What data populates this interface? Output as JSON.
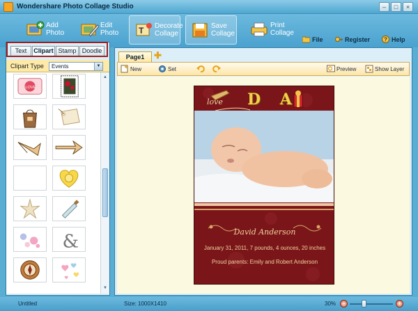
{
  "window": {
    "title": "Wondershare Photo Collage Studio",
    "controls": [
      "minimize",
      "maximize",
      "close"
    ]
  },
  "toolbar": {
    "tools": [
      {
        "name": "add-photo",
        "label": "Add\nPhoto",
        "icon": "add-photo-icon",
        "active": false
      },
      {
        "name": "edit-photo",
        "label": "Edit\nPhoto",
        "icon": "edit-photo-icon",
        "active": false
      },
      {
        "name": "decorate-collage",
        "label": "Decorate\nCollage",
        "icon": "decorate-collage-icon",
        "active": true
      },
      {
        "name": "save-collage",
        "label": "Save\nCollage",
        "icon": "save-collage-icon",
        "active": false
      },
      {
        "name": "print-collage",
        "label": "Print\nCollage",
        "icon": "print-collage-icon",
        "active": false
      }
    ],
    "file_label": "File",
    "register_label": "Register",
    "help_label": "Help"
  },
  "left_panel": {
    "tabs": [
      "Text",
      "Clipart",
      "Stamp",
      "Doodle"
    ],
    "active_tab": "Clipart",
    "clip_type_label": "Clipart Type",
    "clip_type_value": "Events",
    "clips": [
      "valentine-love-clip",
      "framed-roses-clip",
      "gift-bag-clip",
      "gift-tag-clip",
      "arrow-left-clip",
      "arrow-right-clip",
      "blank-clip",
      "yellow-heart-clip",
      "starfish-clip",
      "message-bottle-clip",
      "pink-flowers-clip",
      "ampersand-clip",
      "compass-clip",
      "hearts-doodle-clip"
    ]
  },
  "workspace": {
    "page_tab": "Page1",
    "actions": {
      "new_label": "New",
      "set_label": "Set",
      "preview_label": "Preview",
      "show_layer_label": "Show Layer"
    },
    "collage": {
      "header_letters": "D A",
      "love_text": "love",
      "name": "David Anderson",
      "line1": "January 31, 2011, 7 pounds, 4 ounces, 20 inches",
      "line2": "Proud parents: Emily and Robert Anderson"
    }
  },
  "status": {
    "document": "Untitled",
    "size": "Size: 1000X1410",
    "zoom_label": "30%",
    "zoom_value_percent": 30
  },
  "colors": {
    "chrome_blue": "#5aaed3",
    "collage_red": "#7a1619",
    "gold_text": "#f3d2a0",
    "tab_highlight": "#9a1e1e"
  }
}
